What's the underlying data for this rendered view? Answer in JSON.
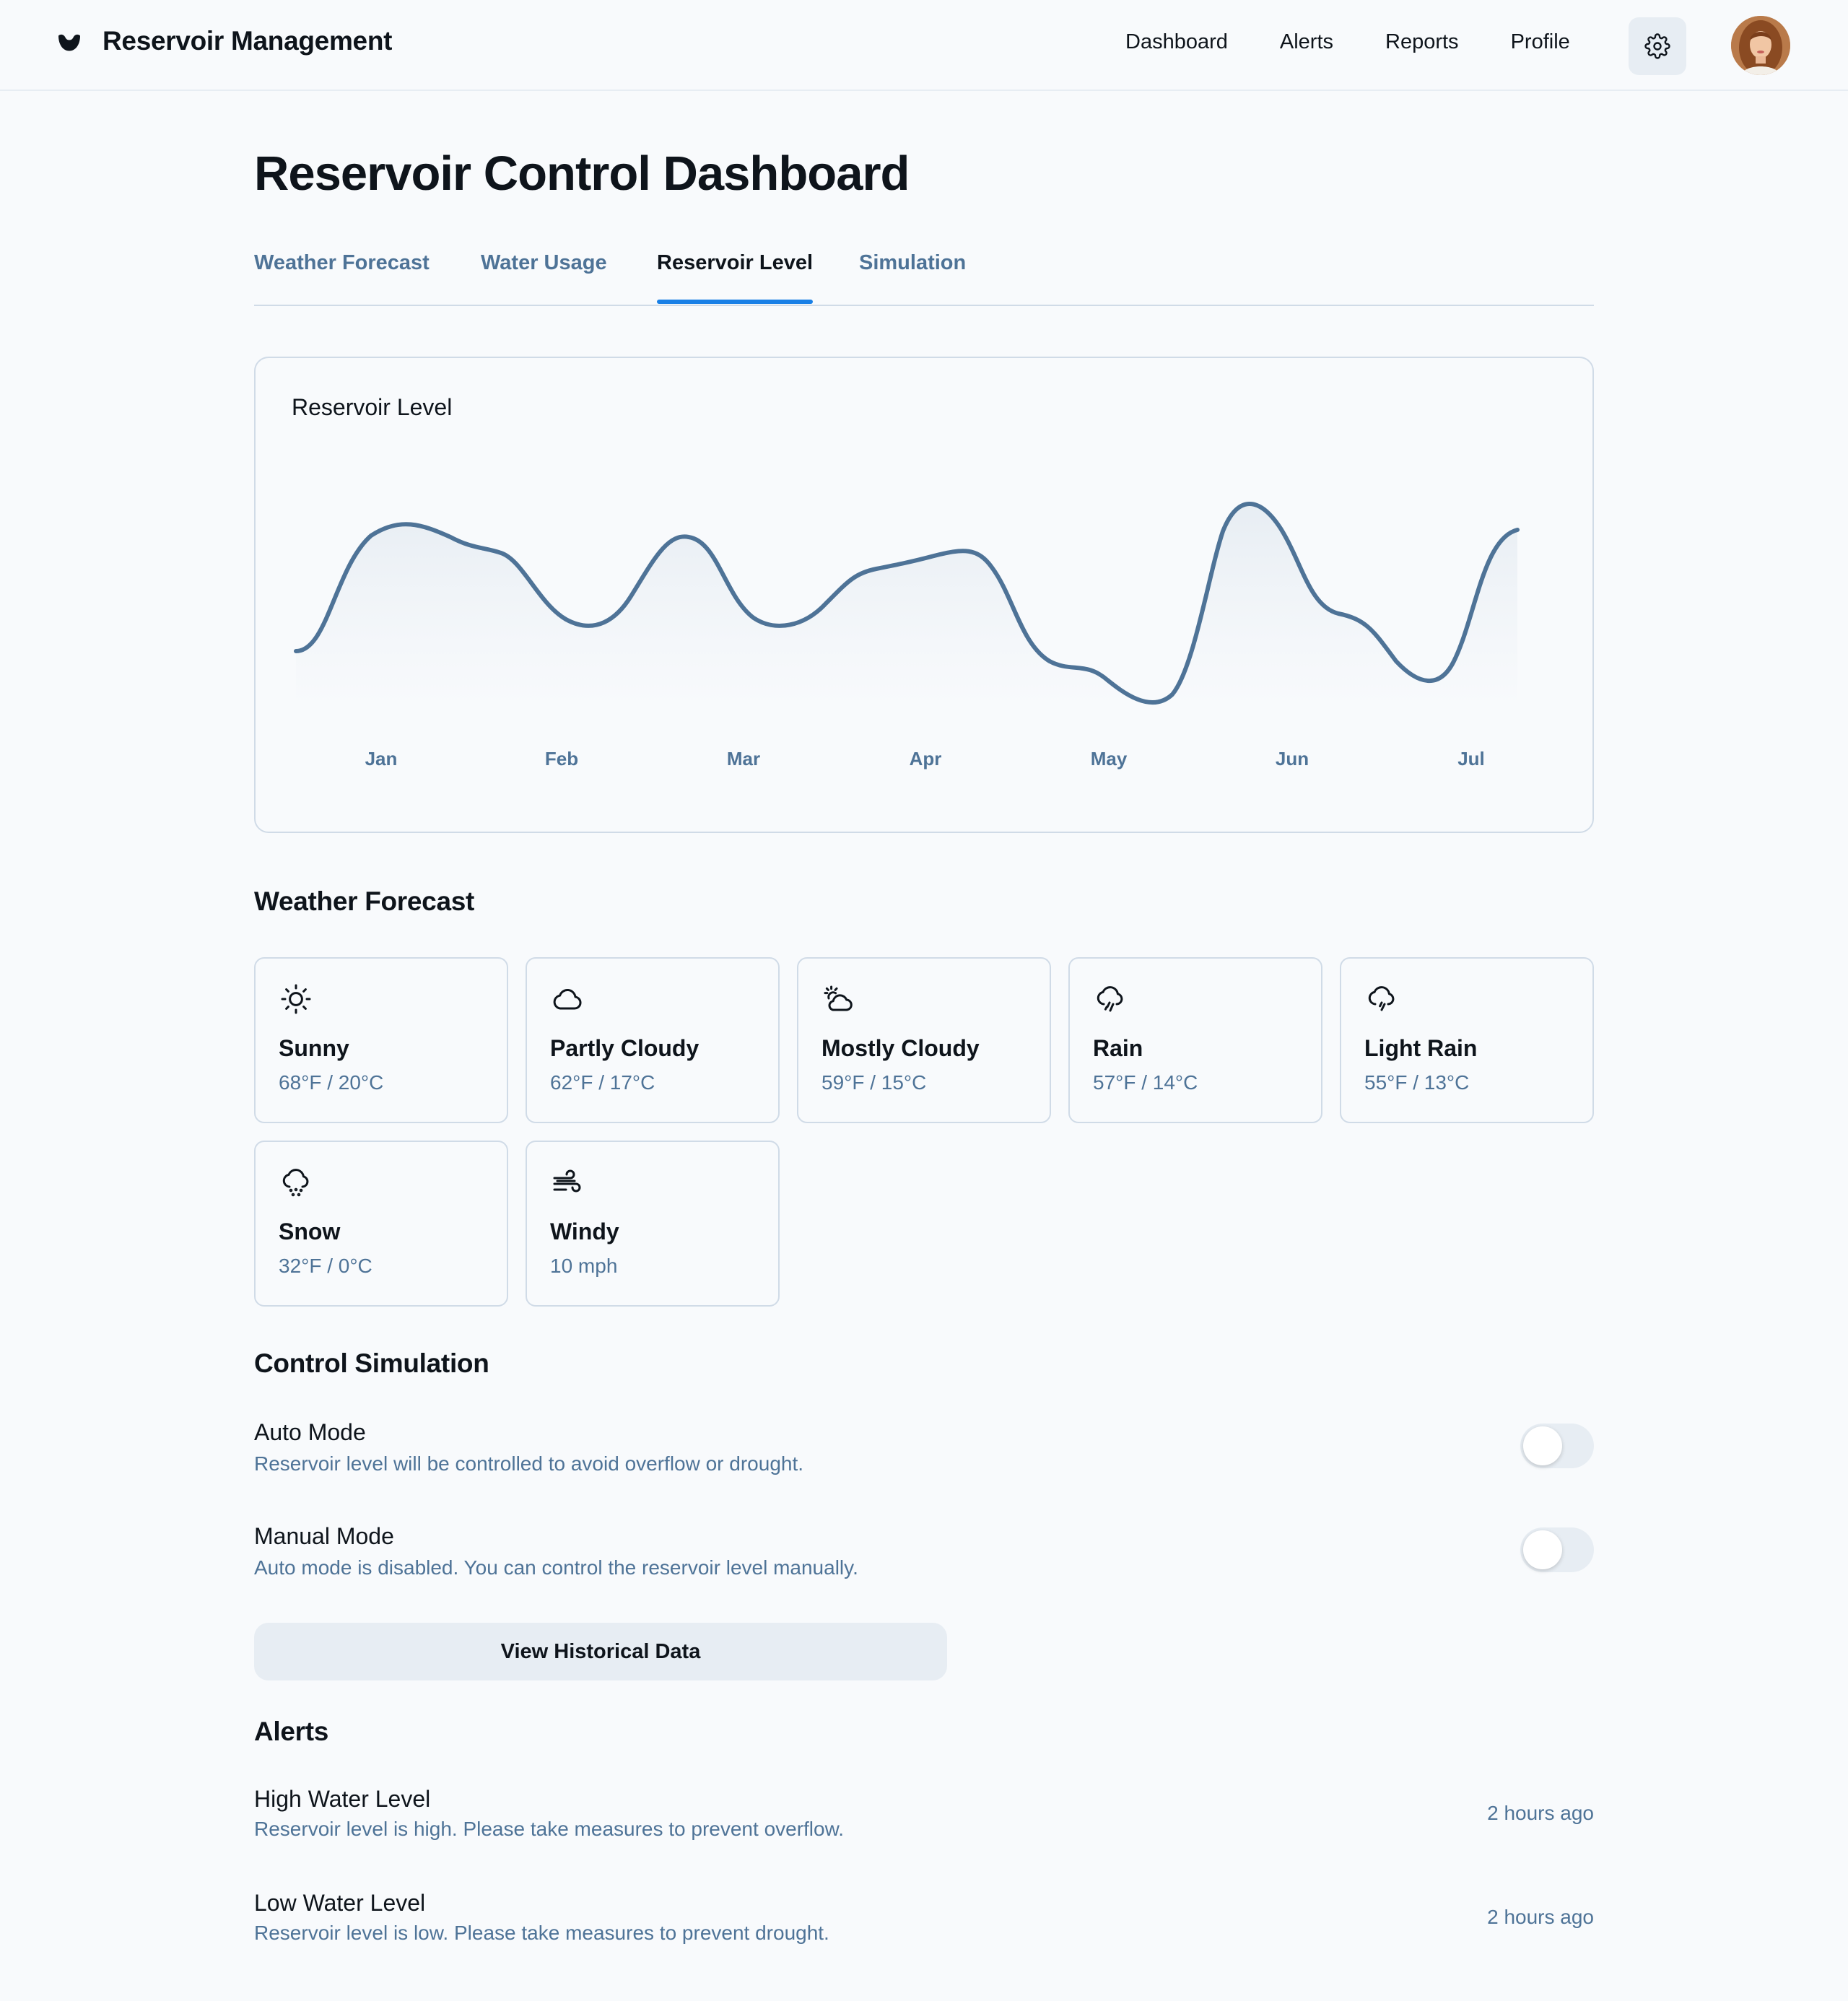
{
  "header": {
    "title": "Reservoir Management",
    "nav": [
      "Dashboard",
      "Alerts",
      "Reports",
      "Profile"
    ]
  },
  "page": {
    "title": "Reservoir Control Dashboard",
    "tabs": [
      {
        "label": "Weather Forecast",
        "active": false
      },
      {
        "label": "Water Usage",
        "active": false
      },
      {
        "label": "Reservoir Level",
        "active": true
      },
      {
        "label": "Simulation",
        "active": false
      }
    ]
  },
  "chart_data": {
    "type": "line",
    "title": "Reservoir Level",
    "categories": [
      "Jan",
      "Feb",
      "Mar",
      "Apr",
      "May",
      "Jun",
      "Jul"
    ],
    "y_axis_shown": false,
    "line_color": "#4e7397"
  },
  "weather": {
    "title": "Weather Forecast",
    "cards": [
      {
        "icon": "sun-icon",
        "name": "Sunny",
        "detail": "68°F / 20°C"
      },
      {
        "icon": "cloud-icon",
        "name": "Partly Cloudy",
        "detail": "62°F / 17°C"
      },
      {
        "icon": "cloud-sun-icon",
        "name": "Mostly Cloudy",
        "detail": "59°F / 15°C"
      },
      {
        "icon": "cloud-rain-icon",
        "name": "Rain",
        "detail": "57°F / 14°C"
      },
      {
        "icon": "cloud-drizzle-icon",
        "name": "Light Rain",
        "detail": "55°F / 13°C"
      },
      {
        "icon": "cloud-snow-icon",
        "name": "Snow",
        "detail": "32°F / 0°C"
      },
      {
        "icon": "wind-icon",
        "name": "Windy",
        "detail": "10 mph"
      }
    ]
  },
  "control": {
    "title": "Control Simulation",
    "auto": {
      "title": "Auto Mode",
      "desc": "Reservoir level will be controlled to avoid overflow or drought.",
      "on": false
    },
    "manual": {
      "title": "Manual Mode",
      "desc": "Auto mode is disabled. You can control the reservoir level manually.",
      "on": false
    },
    "history_button": "View Historical Data"
  },
  "alerts": {
    "title": "Alerts",
    "items": [
      {
        "title": "High Water Level",
        "desc": "Reservoir level is high. Please take measures to prevent overflow.",
        "time": "2 hours ago"
      },
      {
        "title": "Low Water Level",
        "desc": "Reservoir level is low. Please take measures to prevent drought.",
        "time": "2 hours ago"
      }
    ]
  }
}
